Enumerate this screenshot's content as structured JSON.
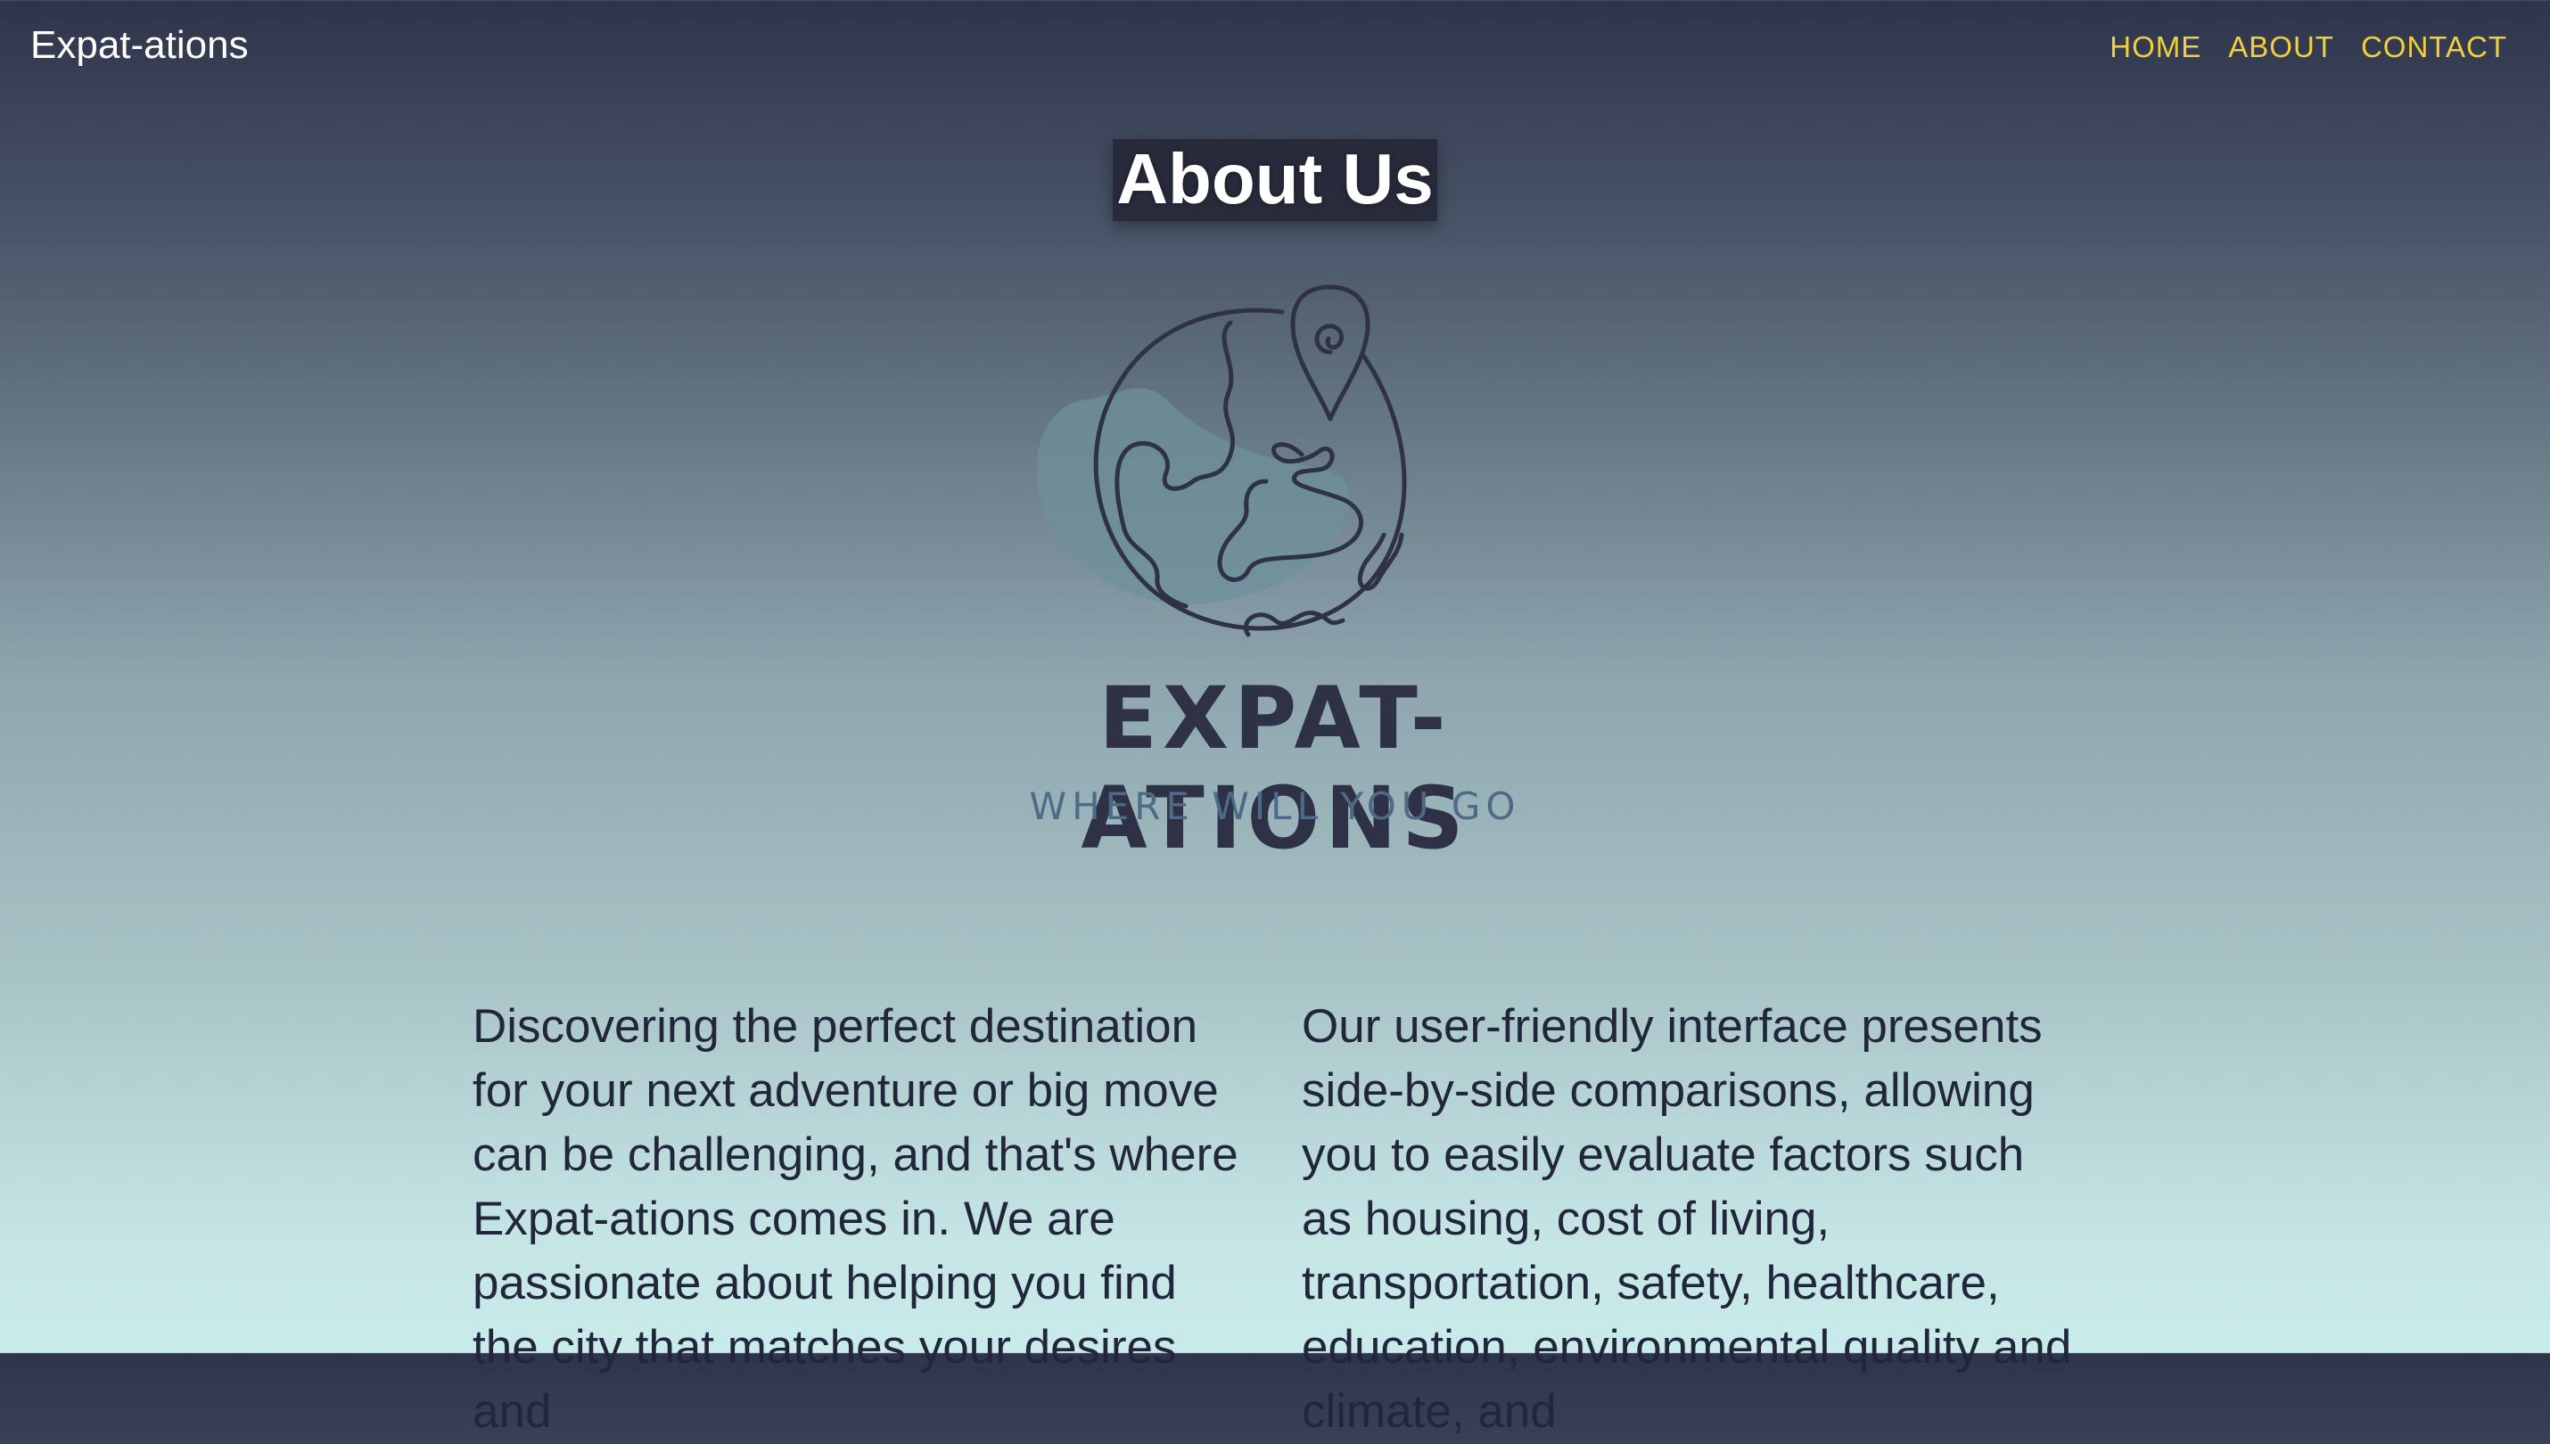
{
  "header": {
    "brand": "Expat-ations",
    "nav": [
      "HOME",
      "ABOUT",
      "CONTACT"
    ]
  },
  "hero": {
    "title": "About Us"
  },
  "logo": {
    "icon": "globe-with-location-pin-icon",
    "wordmark": "EXPAT-ATIONS",
    "tagline": "WHERE WILL YOU GO"
  },
  "about": {
    "paragraph_left": "Discovering the perfect destination for your next adventure or big move can be challenging, and that's where Expat-ations comes in. We are passionate about helping you find the city that matches your desires and",
    "paragraph_right": "Our user-friendly interface presents side-by-side comparisons, allowing you to easily evaluate factors such as housing, cost of living, transportation, safety, healthcare, education, environmental quality and climate, and"
  },
  "colors": {
    "nav_link": "#f2d03b",
    "brand_text": "#ffffff",
    "body_text": "#22263a",
    "logo_dark": "#2f3246",
    "logo_blob": "#6f909c",
    "tagline": "#4d6a86"
  }
}
